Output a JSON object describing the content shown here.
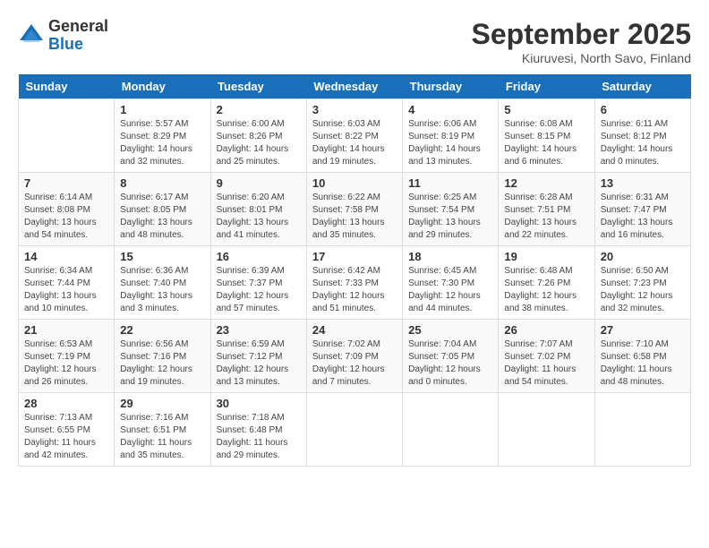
{
  "logo": {
    "general": "General",
    "blue": "Blue"
  },
  "title": "September 2025",
  "subtitle": "Kiuruvesi, North Savo, Finland",
  "days_of_week": [
    "Sunday",
    "Monday",
    "Tuesday",
    "Wednesday",
    "Thursday",
    "Friday",
    "Saturday"
  ],
  "weeks": [
    [
      {
        "day": "",
        "info": ""
      },
      {
        "day": "1",
        "info": "Sunrise: 5:57 AM\nSunset: 8:29 PM\nDaylight: 14 hours\nand 32 minutes."
      },
      {
        "day": "2",
        "info": "Sunrise: 6:00 AM\nSunset: 8:26 PM\nDaylight: 14 hours\nand 25 minutes."
      },
      {
        "day": "3",
        "info": "Sunrise: 6:03 AM\nSunset: 8:22 PM\nDaylight: 14 hours\nand 19 minutes."
      },
      {
        "day": "4",
        "info": "Sunrise: 6:06 AM\nSunset: 8:19 PM\nDaylight: 14 hours\nand 13 minutes."
      },
      {
        "day": "5",
        "info": "Sunrise: 6:08 AM\nSunset: 8:15 PM\nDaylight: 14 hours\nand 6 minutes."
      },
      {
        "day": "6",
        "info": "Sunrise: 6:11 AM\nSunset: 8:12 PM\nDaylight: 14 hours\nand 0 minutes."
      }
    ],
    [
      {
        "day": "7",
        "info": "Sunrise: 6:14 AM\nSunset: 8:08 PM\nDaylight: 13 hours\nand 54 minutes."
      },
      {
        "day": "8",
        "info": "Sunrise: 6:17 AM\nSunset: 8:05 PM\nDaylight: 13 hours\nand 48 minutes."
      },
      {
        "day": "9",
        "info": "Sunrise: 6:20 AM\nSunset: 8:01 PM\nDaylight: 13 hours\nand 41 minutes."
      },
      {
        "day": "10",
        "info": "Sunrise: 6:22 AM\nSunset: 7:58 PM\nDaylight: 13 hours\nand 35 minutes."
      },
      {
        "day": "11",
        "info": "Sunrise: 6:25 AM\nSunset: 7:54 PM\nDaylight: 13 hours\nand 29 minutes."
      },
      {
        "day": "12",
        "info": "Sunrise: 6:28 AM\nSunset: 7:51 PM\nDaylight: 13 hours\nand 22 minutes."
      },
      {
        "day": "13",
        "info": "Sunrise: 6:31 AM\nSunset: 7:47 PM\nDaylight: 13 hours\nand 16 minutes."
      }
    ],
    [
      {
        "day": "14",
        "info": "Sunrise: 6:34 AM\nSunset: 7:44 PM\nDaylight: 13 hours\nand 10 minutes."
      },
      {
        "day": "15",
        "info": "Sunrise: 6:36 AM\nSunset: 7:40 PM\nDaylight: 13 hours\nand 3 minutes."
      },
      {
        "day": "16",
        "info": "Sunrise: 6:39 AM\nSunset: 7:37 PM\nDaylight: 12 hours\nand 57 minutes."
      },
      {
        "day": "17",
        "info": "Sunrise: 6:42 AM\nSunset: 7:33 PM\nDaylight: 12 hours\nand 51 minutes."
      },
      {
        "day": "18",
        "info": "Sunrise: 6:45 AM\nSunset: 7:30 PM\nDaylight: 12 hours\nand 44 minutes."
      },
      {
        "day": "19",
        "info": "Sunrise: 6:48 AM\nSunset: 7:26 PM\nDaylight: 12 hours\nand 38 minutes."
      },
      {
        "day": "20",
        "info": "Sunrise: 6:50 AM\nSunset: 7:23 PM\nDaylight: 12 hours\nand 32 minutes."
      }
    ],
    [
      {
        "day": "21",
        "info": "Sunrise: 6:53 AM\nSunset: 7:19 PM\nDaylight: 12 hours\nand 26 minutes."
      },
      {
        "day": "22",
        "info": "Sunrise: 6:56 AM\nSunset: 7:16 PM\nDaylight: 12 hours\nand 19 minutes."
      },
      {
        "day": "23",
        "info": "Sunrise: 6:59 AM\nSunset: 7:12 PM\nDaylight: 12 hours\nand 13 minutes."
      },
      {
        "day": "24",
        "info": "Sunrise: 7:02 AM\nSunset: 7:09 PM\nDaylight: 12 hours\nand 7 minutes."
      },
      {
        "day": "25",
        "info": "Sunrise: 7:04 AM\nSunset: 7:05 PM\nDaylight: 12 hours\nand 0 minutes."
      },
      {
        "day": "26",
        "info": "Sunrise: 7:07 AM\nSunset: 7:02 PM\nDaylight: 11 hours\nand 54 minutes."
      },
      {
        "day": "27",
        "info": "Sunrise: 7:10 AM\nSunset: 6:58 PM\nDaylight: 11 hours\nand 48 minutes."
      }
    ],
    [
      {
        "day": "28",
        "info": "Sunrise: 7:13 AM\nSunset: 6:55 PM\nDaylight: 11 hours\nand 42 minutes."
      },
      {
        "day": "29",
        "info": "Sunrise: 7:16 AM\nSunset: 6:51 PM\nDaylight: 11 hours\nand 35 minutes."
      },
      {
        "day": "30",
        "info": "Sunrise: 7:18 AM\nSunset: 6:48 PM\nDaylight: 11 hours\nand 29 minutes."
      },
      {
        "day": "",
        "info": ""
      },
      {
        "day": "",
        "info": ""
      },
      {
        "day": "",
        "info": ""
      },
      {
        "day": "",
        "info": ""
      }
    ]
  ]
}
